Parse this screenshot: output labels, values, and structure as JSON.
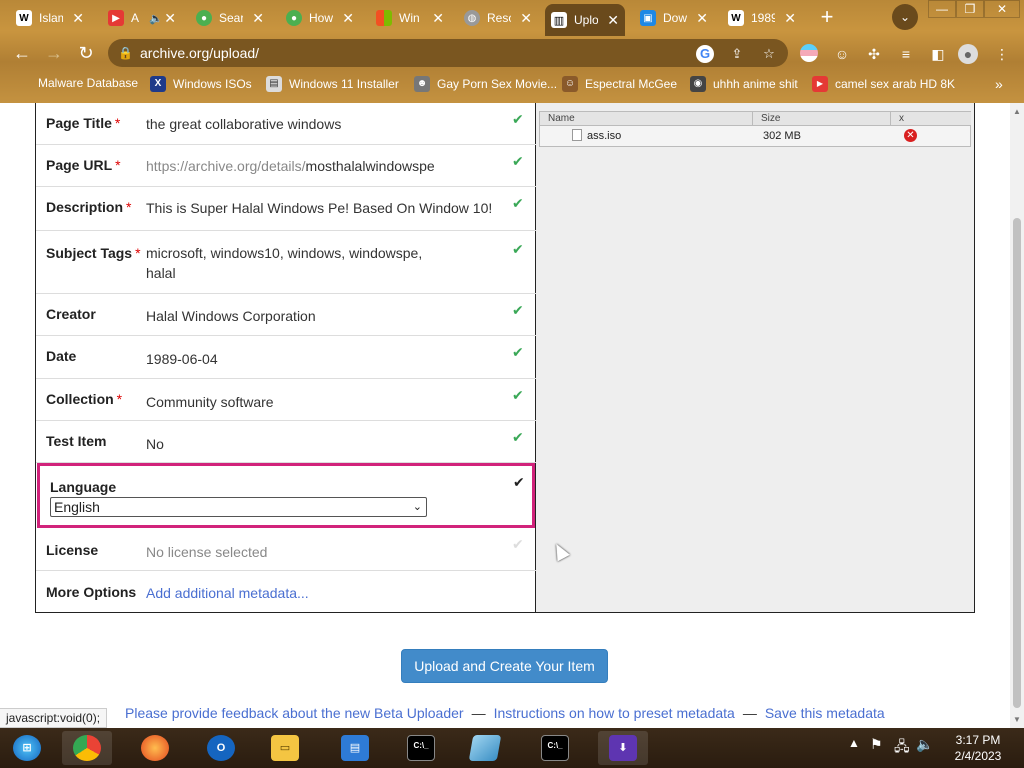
{
  "browser": {
    "tabs": [
      {
        "label": "Islam",
        "favicon": "W",
        "color": "#ffffff",
        "fg": "#000"
      },
      {
        "label": "A",
        "favicon": "YT",
        "color": "#e53935",
        "fg": "#fff",
        "muted": "🔈"
      },
      {
        "label": "Sear",
        "favicon": "●",
        "color": "#4caf50",
        "fg": "#fff"
      },
      {
        "label": "How",
        "favicon": "●",
        "color": "#4caf50",
        "fg": "#fff"
      },
      {
        "label": "Win",
        "favicon": "▦",
        "color": "#f25022",
        "fg": "#fff"
      },
      {
        "label": "Reso",
        "favicon": "◍",
        "color": "#888888",
        "fg": "#fff"
      },
      {
        "label": "Uplo",
        "favicon": "🏛",
        "color": "#222222",
        "fg": "#fff",
        "active": true
      },
      {
        "label": "Dow",
        "favicon": "▣",
        "color": "#1e88e5",
        "fg": "#fff"
      },
      {
        "label": "1989",
        "favicon": "W",
        "color": "#ffffff",
        "fg": "#000"
      }
    ],
    "url": "archive.org/upload/",
    "bookmarks": [
      {
        "label": "Malware Database",
        "icon": ""
      },
      {
        "label": "Windows ISOs",
        "icon": "X"
      },
      {
        "label": "Windows 11 Installer",
        "icon": "▤"
      },
      {
        "label": "Gay Porn Sex Movie...",
        "icon": "☻"
      },
      {
        "label": "Espectral McGee",
        "icon": "☺"
      },
      {
        "label": "uhhh anime shit",
        "icon": "◉"
      },
      {
        "label": "camel sex arab HD 8K",
        "icon": "▶"
      }
    ],
    "bookmarks_overflow": "»"
  },
  "form": {
    "rows": [
      {
        "label": "Page Title",
        "required": true,
        "value": "the great collaborative windows",
        "valid": true
      },
      {
        "label": "Page URL",
        "required": true,
        "value_prefix": "https://archive.org/details/",
        "value": "mosthalalwindowspe",
        "valid": true
      },
      {
        "label": "Description",
        "required": true,
        "value": "This is Super Halal Windows Pe! Based On Window 10!",
        "valid": true
      },
      {
        "label": "Subject Tags",
        "required": true,
        "value": "microsoft, windows10, windows, windowspe, halal",
        "valid": true
      },
      {
        "label": "Creator",
        "required": false,
        "value": "Halal Windows Corporation",
        "valid": true
      },
      {
        "label": "Date",
        "required": false,
        "value": "1989-06-04",
        "valid": true
      },
      {
        "label": "Collection",
        "required": true,
        "value": "Community software",
        "valid": true
      },
      {
        "label": "Test Item",
        "required": false,
        "value": "No",
        "valid": true
      }
    ],
    "language": {
      "label": "Language",
      "selected": "English"
    },
    "license": {
      "label": "License",
      "value": "No license selected"
    },
    "more_options": {
      "label": "More Options",
      "link": "Add additional metadata..."
    },
    "required_mark": "*",
    "check_glyph": "✔"
  },
  "files": {
    "headers": {
      "name": "Name",
      "size": "Size",
      "remove": "x"
    },
    "items": [
      {
        "name": "ass.iso",
        "size": "302 MB"
      }
    ]
  },
  "actions": {
    "upload_label": "Upload and Create Your Item"
  },
  "footer": {
    "feedback": "Please provide feedback about the new Beta Uploader",
    "instructions": "Instructions on how to preset metadata",
    "save": "Save this metadata",
    "separator": "—"
  },
  "status_bar": "javascript:void(0);",
  "taskbar": {
    "time": "3:17 PM",
    "date": "2/4/2023"
  }
}
